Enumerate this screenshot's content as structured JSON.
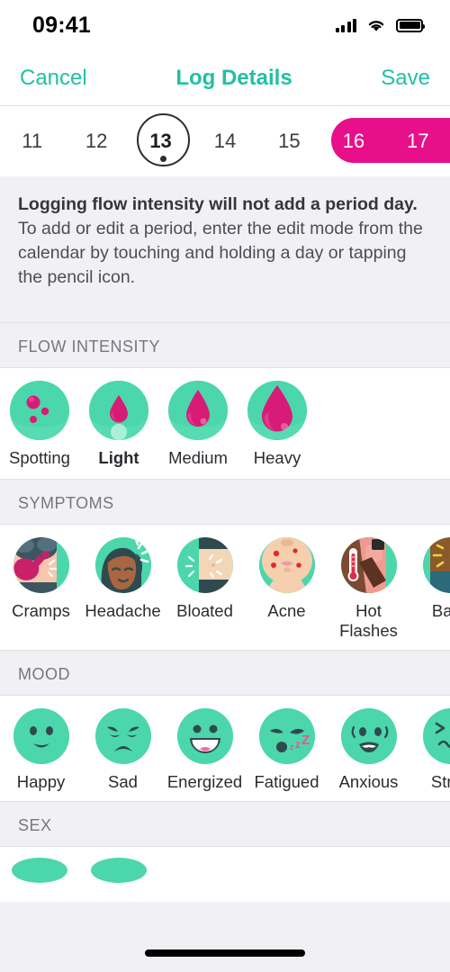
{
  "status_bar": {
    "time": "09:41",
    "signal_icon": "cellular-signal-icon",
    "wifi_icon": "wifi-icon",
    "battery_icon": "battery-full-icon"
  },
  "nav": {
    "cancel_label": "Cancel",
    "title": "Log Details",
    "save_label": "Save"
  },
  "date_strip": {
    "days": [
      {
        "label": "11",
        "in_period": false,
        "selected": false
      },
      {
        "label": "12",
        "in_period": false,
        "selected": false
      },
      {
        "label": "13",
        "in_period": false,
        "selected": true
      },
      {
        "label": "14",
        "in_period": false,
        "selected": false
      },
      {
        "label": "15",
        "in_period": false,
        "selected": false
      },
      {
        "label": "16",
        "in_period": true,
        "selected": false
      },
      {
        "label": "17",
        "in_period": true,
        "selected": false
      }
    ],
    "selected_day": "13",
    "period_color": "#E8108A"
  },
  "info_banner": {
    "bold_text": "Logging flow intensity will not add a period day.",
    "rest_text": " To add or edit a period, enter the edit mode from the calendar by touching and holding a day or tapping the pencil icon."
  },
  "sections": {
    "flow": {
      "header": "FLOW INTENSITY",
      "options": [
        {
          "label": "Spotting",
          "icon": "blood-spots-icon",
          "selected": false
        },
        {
          "label": "Light",
          "icon": "small-blood-drop-icon",
          "selected": true
        },
        {
          "label": "Medium",
          "icon": "medium-blood-drop-icon",
          "selected": false
        },
        {
          "label": "Heavy",
          "icon": "large-blood-drop-icon",
          "selected": false
        }
      ]
    },
    "symptoms": {
      "header": "SYMPTOMS",
      "options": [
        {
          "label": "Cramps",
          "icon": "cramps-icon",
          "selected": false
        },
        {
          "label": "Headache",
          "icon": "headache-icon",
          "selected": false
        },
        {
          "label": "Bloated",
          "icon": "bloated-icon",
          "selected": false
        },
        {
          "label": "Acne",
          "icon": "acne-icon",
          "selected": false
        },
        {
          "label": "Hot\nFlashes",
          "icon": "hot-flashes-icon",
          "selected": false
        },
        {
          "label": "Back",
          "icon": "back-pain-icon",
          "selected": false
        }
      ]
    },
    "mood": {
      "header": "MOOD",
      "options": [
        {
          "label": "Happy",
          "icon": "happy-face-icon",
          "selected": false
        },
        {
          "label": "Sad",
          "icon": "sad-face-icon",
          "selected": false
        },
        {
          "label": "Energized",
          "icon": "energized-face-icon",
          "selected": false
        },
        {
          "label": "Fatigued",
          "icon": "fatigued-face-icon",
          "selected": false
        },
        {
          "label": "Anxious",
          "icon": "anxious-face-icon",
          "selected": false
        },
        {
          "label": "Stres",
          "icon": "stressed-face-icon",
          "selected": false
        }
      ]
    },
    "sex": {
      "header": "SEX",
      "options": [
        {
          "label": "",
          "icon": "sex-option-icon-1",
          "selected": false
        },
        {
          "label": "",
          "icon": "sex-option-icon-2",
          "selected": false
        }
      ]
    }
  },
  "colors": {
    "accent_teal": "#21C0A4",
    "avatar_teal": "#4CD6AC",
    "period_pink": "#E8108A",
    "blood_pink": "#D81B76",
    "background_grey": "#F1F1F5"
  }
}
